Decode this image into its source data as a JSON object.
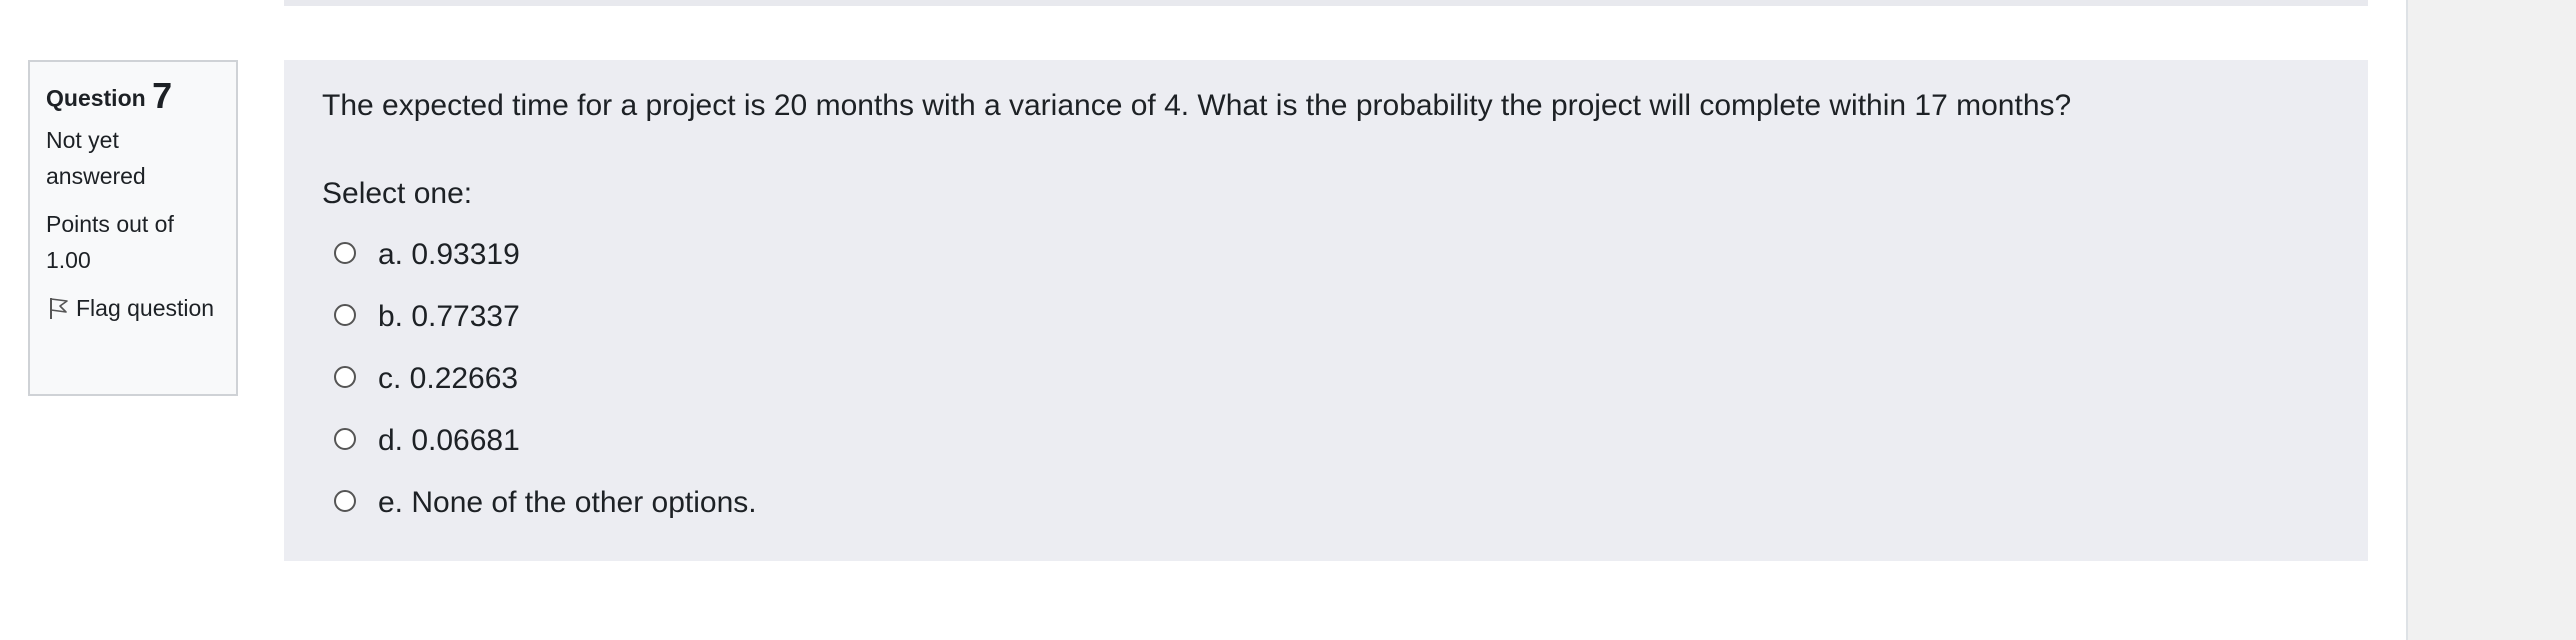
{
  "question_info": {
    "question_word": "Question",
    "number": "7",
    "state": "Not yet answered",
    "grade": "Points out of 1.00",
    "flag_label": "Flag question",
    "flag_icon": "flag-icon"
  },
  "question": {
    "text": "The expected time for a project is 20 months with a variance of 4. What is the probability the project will complete within 17 months?",
    "prompt": "Select one:",
    "options": [
      {
        "label": "a. 0.93319",
        "selected": false
      },
      {
        "label": "b. 0.77337",
        "selected": false
      },
      {
        "label": "c. 0.22663",
        "selected": false
      },
      {
        "label": "d. 0.06681",
        "selected": false
      },
      {
        "label": "e. None of the other options.",
        "selected": false
      }
    ]
  },
  "colors": {
    "content_bg": "#ecedf2",
    "info_bg": "#f8f9fa",
    "sidebar_bg": "#f1f1f1"
  }
}
